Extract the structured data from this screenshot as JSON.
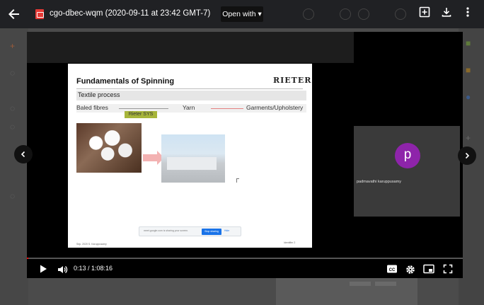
{
  "topbar": {
    "file_title": "cgo-dbec-wqm (2020-09-11 at 23:42 GMT-7)",
    "open_with_label": "Open with ▾"
  },
  "slide": {
    "title": "Fundamentals of Spinning",
    "logo_text": "RIETER",
    "process_label": "Textile process",
    "flow": {
      "source": "Baled fibres",
      "middle": "Yarn",
      "target": "Garments/Upholstery",
      "badge": "Rieter SYS"
    },
    "share_bar": {
      "message": "meet.google.com is sharing your screen.",
      "stop_label": "Stop sharing",
      "hide_label": "Hide"
    },
    "footer_left": "Sep. 2020   S. Karuppusamy",
    "footer_right": "Identifier   2"
  },
  "participant": {
    "initial": "p",
    "name": "padmavathi karuppusamy",
    "avatar_color": "#8e24aa"
  },
  "player": {
    "time_display": "0:13 / 1:08:16",
    "progress_fraction": 0.0032
  },
  "icons": {
    "back": "arrow-left-icon",
    "file": "video-file-icon",
    "add_to_drive": "add-to-drive-icon",
    "download": "download-icon",
    "more": "more-vert-icon",
    "play": "play-icon",
    "volume": "volume-icon",
    "captions": "captions-icon",
    "settings": "gear-icon",
    "miniplayer": "miniplayer-icon",
    "fullscreen": "fullscreen-icon"
  },
  "colors": {
    "accent_red": "#ff0000",
    "avatar": "#8e24aa",
    "badge": "#a7b53a"
  }
}
